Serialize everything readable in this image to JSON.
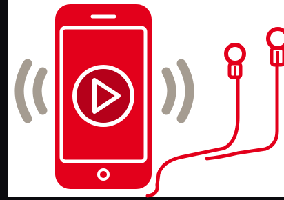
{
  "illustration": {
    "subject": "phone-with-earphones-playing-audio",
    "icons": [
      "smartphone-icon",
      "play-icon",
      "sound-waves-icon",
      "earphones-icon"
    ],
    "colors": {
      "background": "#0b0b0f",
      "canvas": "#ffffff",
      "phone_red": "#e3001b",
      "play_dark_red": "#b5001a",
      "outline_white": "#ffffff",
      "wave_gray": "#a59c91"
    }
  }
}
